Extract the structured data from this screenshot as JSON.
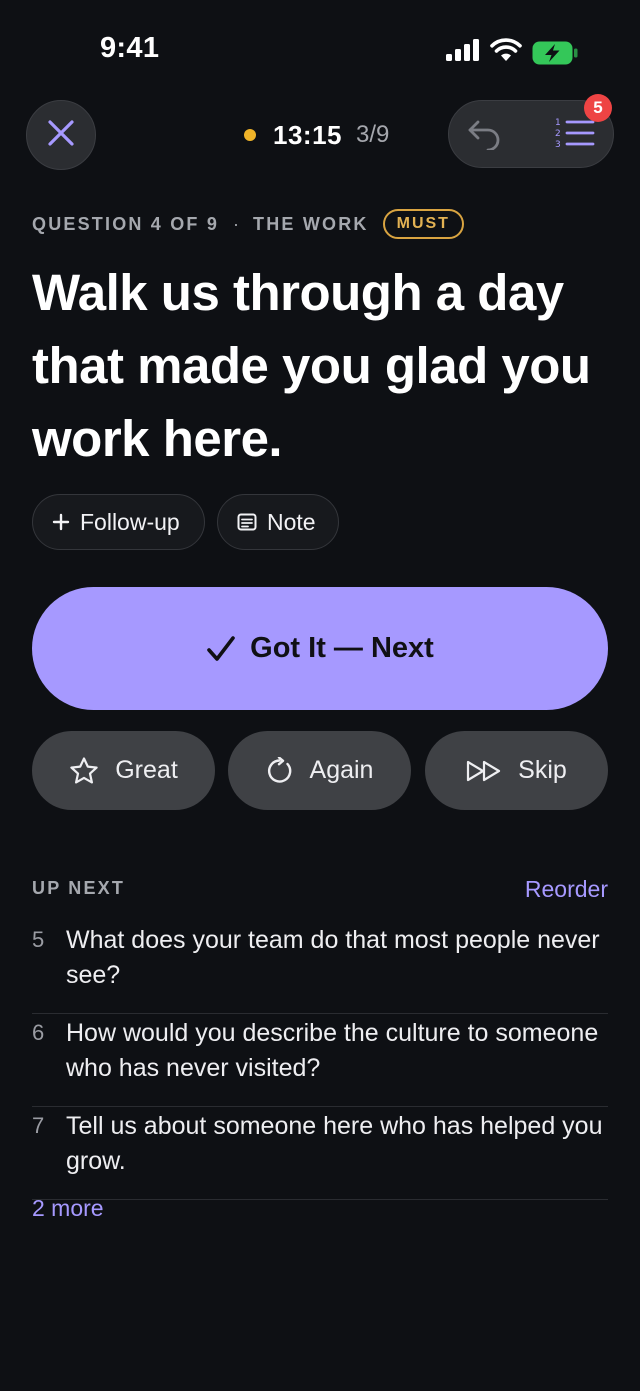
{
  "status_bar": {
    "time": "9:41",
    "icons": [
      "cellular-signal-icon",
      "wifi-icon",
      "battery-charging-icon"
    ],
    "battery_color": "#34c759"
  },
  "top_bar": {
    "close_icon": "close-icon",
    "timer": "13:15",
    "timer_dot_color": "#f0b429",
    "progress": "3/9",
    "undo_icon": "undo-icon",
    "list_icon": "numbered-list-icon",
    "badge_count": "5"
  },
  "question": {
    "meta_prefix": "QUESTION 4 OF 9",
    "meta_separator": "·",
    "section": "THE WORK",
    "tag": "MUST",
    "title": "Walk us through a day that made you glad you work here."
  },
  "chips": {
    "followup_label": "Follow-up",
    "note_label": "Note"
  },
  "actions": {
    "primary_label": "Got It — Next",
    "great_label": "Great",
    "again_label": "Again",
    "skip_label": "Skip"
  },
  "up_next": {
    "label": "UP NEXT",
    "reorder_label": "Reorder",
    "items": [
      {
        "number": "5",
        "text": "What does your team do that most people never see?"
      },
      {
        "number": "6",
        "text": "How would you describe the culture to someone who has never visited?"
      },
      {
        "number": "7",
        "text": "Tell us about someone here who has helped you grow."
      }
    ],
    "more_label": "2 more"
  },
  "colors": {
    "background": "#0e1014",
    "accent": "#a699ff",
    "must_tag": "#d9a441",
    "badge": "#ee4444"
  }
}
